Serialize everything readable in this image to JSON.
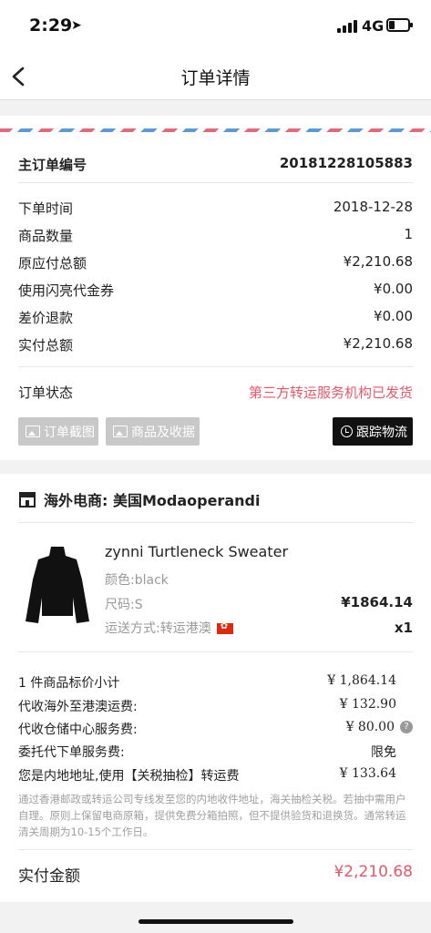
{
  "status_bar": {
    "time": "2:29",
    "network": "4G"
  },
  "nav": {
    "title": "订单详情"
  },
  "order": {
    "main_no_label": "主订单编号",
    "main_no": "20181228105883",
    "rows": [
      {
        "label": "下单时间",
        "value": "2018-12-28"
      },
      {
        "label": "商品数量",
        "value": "1"
      },
      {
        "label": "原应付总额",
        "value": "¥2,210.68"
      },
      {
        "label": "使用闪亮代金券",
        "value": "¥0.00"
      },
      {
        "label": "差价退款",
        "value": "¥0.00"
      },
      {
        "label": "实付总额",
        "value": "¥2,210.68"
      }
    ],
    "status_label": "订单状态",
    "status_value": "第三方转运服务机构已发货",
    "btn_screenshot": "订单截图",
    "btn_goods_receipt": "商品及收据",
    "btn_track": "跟踪物流"
  },
  "store": {
    "name": "海外电商: 美国Modaoperandi"
  },
  "product": {
    "name": "zynni Turtleneck Sweater",
    "color": "颜色:black",
    "size": "尺码:S",
    "shipping": "运送方式:转运港澳",
    "price": "¥1864.14",
    "qty": "x1"
  },
  "fees": [
    {
      "label": "1 件商品标价小计",
      "value": "¥ 1,864.14"
    },
    {
      "label": "代收海外至港澳运费:",
      "value": "¥ 132.90"
    },
    {
      "label": "代收仓储中心服务费:",
      "value": "¥ 80.00"
    },
    {
      "label": "委托代下单服务费:",
      "value": "限免"
    },
    {
      "label": "您是内地地址,使用【关税抽检】转运费",
      "value": "¥ 133.64"
    }
  ],
  "note": "通过香港邮政或转运公司专线发至您的内地收件地址，海关抽检关税。若抽中需用户自理。原则上保留电商原箱，提供免费分箱拍照，但不提供验货和退换货。通常转运清关周期为10-15个工作日。",
  "total": {
    "label": "实付金额",
    "value": "¥2,210.68"
  },
  "colors": {
    "accent_red": "#e8576a",
    "button_dark": "#111111",
    "button_gray": "#c8c8c8"
  },
  "battery_level": 0.3
}
